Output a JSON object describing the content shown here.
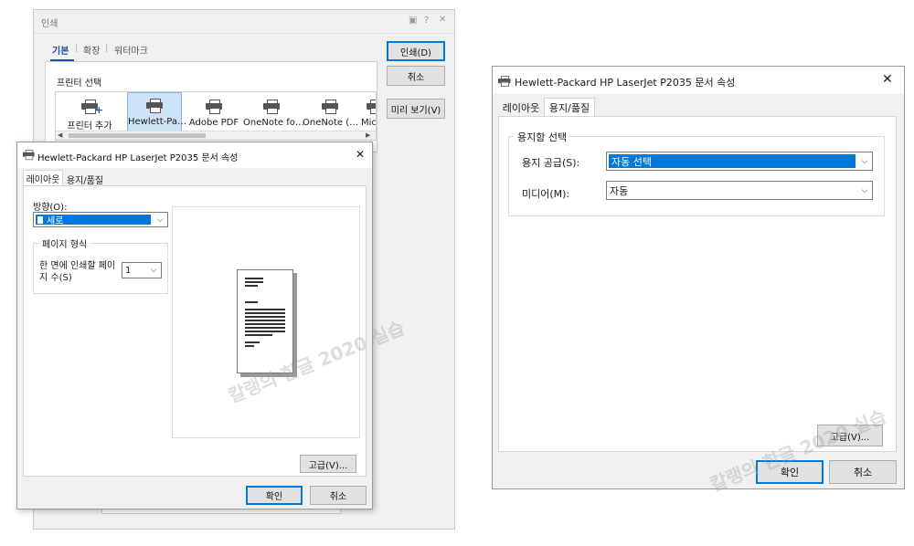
{
  "print_dialog": {
    "title": "인쇄",
    "tabs": [
      "기본",
      "확장",
      "워터마크"
    ],
    "printer_section_label": "프린터 선택",
    "printers": [
      "프린터 추가",
      "Hewlett-Pa…",
      "Adobe PDF",
      "OneNote fo…",
      "OneNote (…",
      "Micr"
    ],
    "buttons": {
      "print": "인쇄(D)",
      "cancel": "취소",
      "preview": "미리 보기(V)"
    }
  },
  "layout_dialog": {
    "title": "Hewlett-Packard HP LaserJet P2035 문서 속성",
    "tabs": [
      "레이아웃",
      "용지/품질"
    ],
    "orientation_label": "방향(O):",
    "orientation_value": "세로",
    "page_format_group": "페이지 형식",
    "pages_per_sheet_label": "한 면에 인쇄할 페이지 수(S)",
    "pages_per_sheet_value": "1",
    "advanced_button": "고급(V)...",
    "ok_button": "확인",
    "cancel_button": "취소"
  },
  "paper_dialog": {
    "title": "Hewlett-Packard HP LaserJet P2035 문서 속성",
    "tabs": [
      "레이아웃",
      "용지/품질"
    ],
    "tray_group": "용지함 선택",
    "paper_source_label": "용지 공급(S):",
    "paper_source_value": "자동 선택",
    "media_label": "미디어(M):",
    "media_value": "자동",
    "advanced_button": "고급(V)...",
    "ok_button": "확인",
    "cancel_button": "취소"
  },
  "watermark": "칼랭의 한글 2020 실습"
}
